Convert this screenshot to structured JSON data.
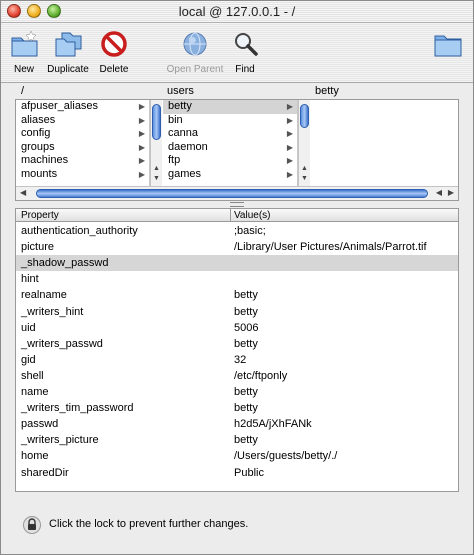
{
  "window": {
    "title": "local @ 127.0.0.1 - /"
  },
  "toolbar": {
    "new": "New",
    "duplicate": "Duplicate",
    "delete": "Delete",
    "open_parent": "Open Parent",
    "find": "Find"
  },
  "browser": {
    "headers": [
      "/",
      "users",
      "betty"
    ],
    "col1": [
      "afpuser_aliases",
      "aliases",
      "config",
      "groups",
      "machines",
      "mounts"
    ],
    "col2": [
      "betty",
      "bin",
      "canna",
      "daemon",
      "ftp",
      "games"
    ]
  },
  "table": {
    "headers": {
      "property": "Property",
      "values": "Value(s)"
    },
    "rows": [
      {
        "k": "authentication_authority",
        "v": ";basic;"
      },
      {
        "k": "picture",
        "v": "/Library/User Pictures/Animals/Parrot.tif"
      },
      {
        "k": "_shadow_passwd",
        "v": ""
      },
      {
        "k": "hint",
        "v": ""
      },
      {
        "k": "realname",
        "v": "betty"
      },
      {
        "k": "_writers_hint",
        "v": "betty"
      },
      {
        "k": "uid",
        "v": "5006"
      },
      {
        "k": "_writers_passwd",
        "v": "betty"
      },
      {
        "k": "gid",
        "v": "32"
      },
      {
        "k": "shell",
        "v": "/etc/ftponly"
      },
      {
        "k": "name",
        "v": "betty"
      },
      {
        "k": "_writers_tim_password",
        "v": "betty"
      },
      {
        "k": "passwd",
        "v": "h2d5A/jXhFANk"
      },
      {
        "k": "_writers_picture",
        "v": "betty"
      },
      {
        "k": "home",
        "v": "/Users/guests/betty/./"
      },
      {
        "k": "sharedDir",
        "v": "Public"
      }
    ]
  },
  "lock": {
    "text": "Click the lock to prevent further changes."
  },
  "colors": {
    "selection": "#d4d4d4",
    "scroll_thumb": "#5a8fe0"
  }
}
